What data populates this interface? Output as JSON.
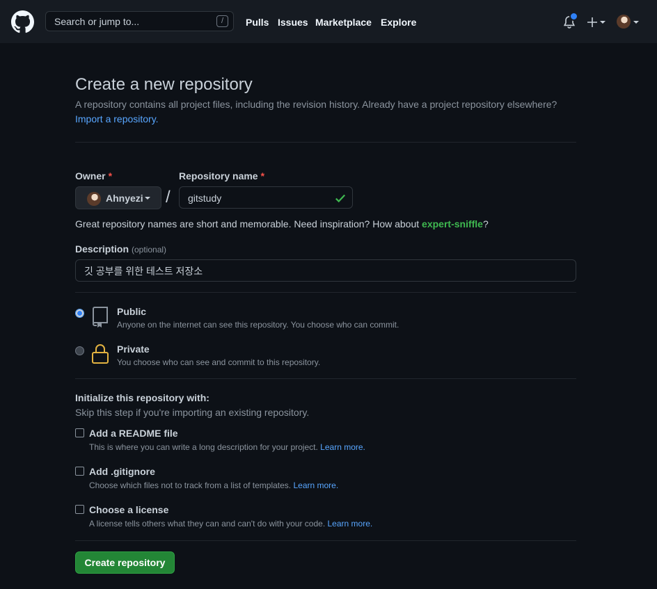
{
  "header": {
    "search_placeholder": "Search or jump to...",
    "search_shortcut": "/",
    "nav": [
      "Pulls",
      "Issues",
      "Marketplace",
      "Explore"
    ]
  },
  "page": {
    "title": "Create a new repository",
    "subtitle": "A repository contains all project files, including the revision history. Already have a project repository elsewhere?",
    "import_link": "Import a repository."
  },
  "form": {
    "owner_label": "Owner",
    "owner_value": "Ahnyezi",
    "repo_label": "Repository name",
    "repo_value": "gitstudy",
    "required_mark": "*",
    "separator": "/",
    "hint_prefix": "Great repository names are short and memorable. Need inspiration? How about ",
    "hint_suggestion": "expert-sniffle",
    "hint_suffix": "?",
    "description_label": "Description",
    "description_optional": "(optional)",
    "description_value": "깃 공부를 위한 테스트 저장소"
  },
  "visibility": [
    {
      "title": "Public",
      "desc": "Anyone on the internet can see this repository. You choose who can commit.",
      "selected": true
    },
    {
      "title": "Private",
      "desc": "You choose who can see and commit to this repository.",
      "selected": false
    }
  ],
  "init": {
    "title": "Initialize this repository with:",
    "subtitle": "Skip this step if you're importing an existing repository.",
    "options": [
      {
        "title": "Add a README file",
        "desc": "This is where you can write a long description for your project.",
        "link": "Learn more."
      },
      {
        "title": "Add .gitignore",
        "desc": "Choose which files not to track from a list of templates.",
        "link": "Learn more."
      },
      {
        "title": "Choose a license",
        "desc": "A license tells others what they can and can't do with your code.",
        "link": "Learn more."
      }
    ]
  },
  "submit_label": "Create repository",
  "colors": {
    "background": "#0d1117",
    "header": "#161b22",
    "link": "#58a6ff",
    "success": "#3fb950",
    "primary_button": "#238636",
    "required": "#f85149",
    "private_lock": "#e3b341"
  }
}
